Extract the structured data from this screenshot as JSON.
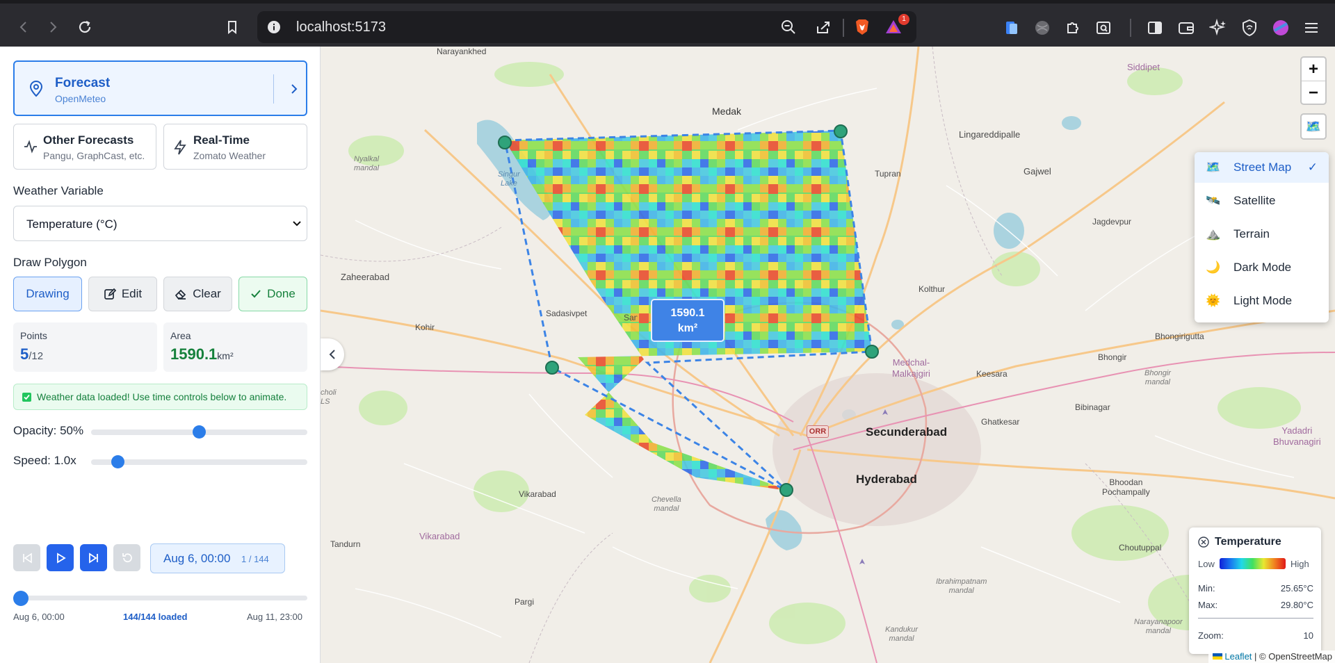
{
  "browser": {
    "url": "localhost:5173",
    "notification_count": "1"
  },
  "sidebar": {
    "forecast": {
      "title": "Forecast",
      "subtitle": "OpenMeteo"
    },
    "other_forecasts": {
      "title": "Other Forecasts",
      "subtitle": "Pangu, GraphCast, etc."
    },
    "real_time": {
      "title": "Real-Time",
      "subtitle": "Zomato Weather"
    },
    "weather_variable_label": "Weather Variable",
    "weather_variable_value": "Temperature (°C)",
    "draw_polygon_label": "Draw Polygon",
    "buttons": {
      "drawing": "Drawing",
      "edit": "Edit",
      "clear": "Clear",
      "done": "Done"
    },
    "points": {
      "label": "Points",
      "value": "5",
      "max": "/12"
    },
    "area": {
      "label": "Area",
      "value": "1590.1",
      "unit": "km²"
    },
    "notice": "Weather data loaded! Use time controls below to animate.",
    "opacity": {
      "label": "Opacity: 50%",
      "fraction": 0.5
    },
    "speed": {
      "label": "Speed: 1.0x",
      "fraction": 0.1
    },
    "time": {
      "current": "Aug 6, 00:00",
      "frame": "1 / 144",
      "fraction": 0.0
    },
    "timeline": {
      "start": "Aug 6, 00:00",
      "loaded": "144/144 loaded",
      "end": "Aug 11, 23:00"
    }
  },
  "map": {
    "area_badge": {
      "value": "1590.1",
      "unit": "km²"
    },
    "places": {
      "narayankhed": "Narayankhed",
      "medak": "Medak",
      "siddipet": "Siddipet",
      "lingareddipalle": "Lingareddipalle",
      "tupran": "Tupran",
      "gajwel": "Gajwel",
      "jagdevpur": "Jagdevpur",
      "zaheerabad": "Zaheerabad",
      "kohir": "Kohir",
      "sadasivpet": "Sadasivpet",
      "sangareddy": "Sangareddy",
      "kolthur": "Kolthur",
      "bibinagar": "Bibinagar",
      "bhongir": "Bhongir",
      "keesara": "Keesara",
      "ghatkesar": "Ghatkesar",
      "secunderabad": "Secunderabad",
      "hyderabad": "Hyderabad",
      "vikarabad": "Vikarabad",
      "vikarabad_district": "Vikarabad",
      "tandurn": "Tandurn",
      "pargi": "Pargi",
      "choutuppal": "Choutuppal",
      "bhoodan": "Bhoodan\nPochampally",
      "yadadri": "Yadadri\nBhuvanagiri",
      "bhongir_m": "Bhongir\nmandal",
      "medchal": "Medchal-\nMalkajgiri",
      "nyalkal": "Nyalkal\nmandal",
      "singur": "Singur\nLake",
      "chevella": "Chevella\nmandal",
      "ibrahimpatnam": "Ibrahimpatnam\nmandal",
      "narayanpoor": "Narayanapoor\nmandal",
      "kandukur": "Kandukur\nmandal",
      "bhongir_r": "Bhongirigutta",
      "orr": "ORR",
      "choli": "choli\nLS"
    },
    "layers": [
      {
        "label": "Street Map",
        "icon": "street-map-icon",
        "active": true,
        "check": "✓"
      },
      {
        "label": "Satellite",
        "icon": "satellite-icon",
        "active": false
      },
      {
        "label": "Terrain",
        "icon": "terrain-icon",
        "active": false
      },
      {
        "label": "Dark Mode",
        "icon": "moon-icon",
        "active": false
      },
      {
        "label": "Light Mode",
        "icon": "sun-icon",
        "active": false
      }
    ],
    "legend": {
      "title": "Temperature",
      "low": "Low",
      "high": "High",
      "min_label": "Min:",
      "min_value": "25.65°C",
      "max_label": "Max:",
      "max_value": "29.80°C",
      "zoom_label": "Zoom:",
      "zoom_value": "10"
    },
    "attribution": {
      "leaflet": "Leaflet",
      "rest": " | © OpenStreetMap"
    },
    "zoom_in": "+",
    "zoom_out": "−"
  }
}
